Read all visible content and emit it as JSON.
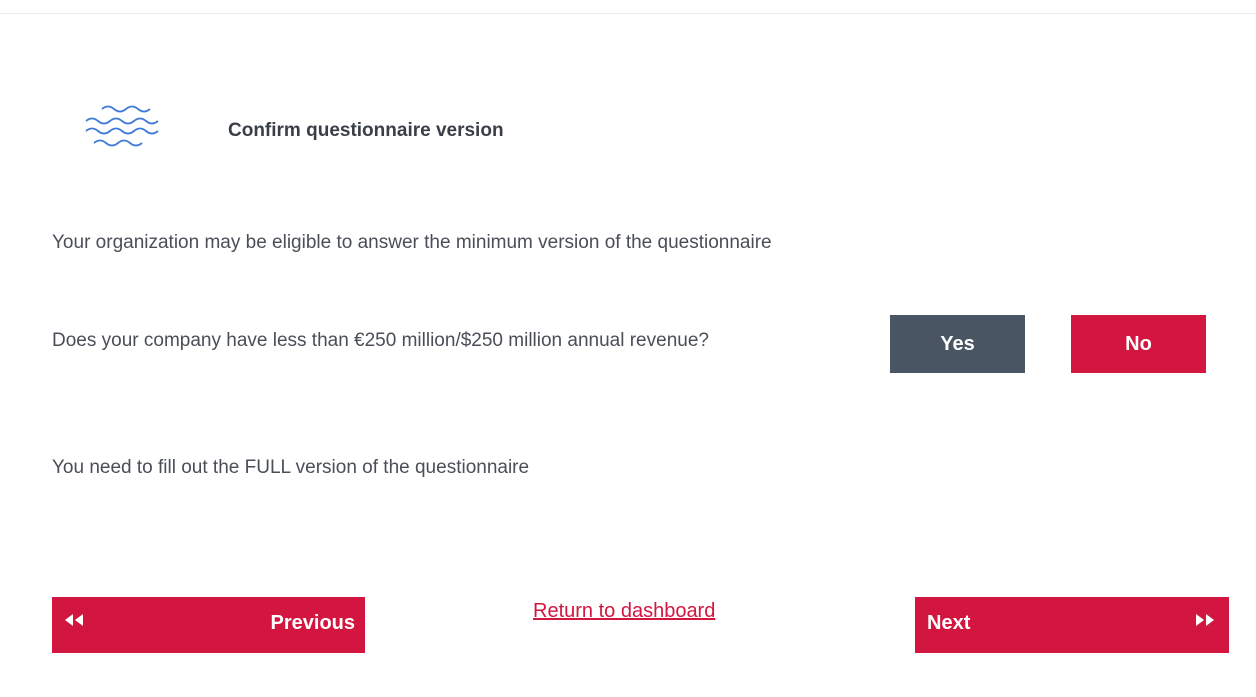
{
  "header": {
    "icon": "wave-icon",
    "title": "Confirm questionnaire version"
  },
  "intro_text": "Your organization may be eligible to answer the minimum version of the questionnaire",
  "question": {
    "text": "Does your company have less than €250 million/$250 million annual revenue?",
    "yes_label": "Yes",
    "no_label": "No"
  },
  "result_text": "You need to fill out the FULL version of the questionnaire",
  "navigation": {
    "previous_label": "Previous",
    "previous_icon": "double-chevron-left-icon",
    "dashboard_link": "Return to dashboard",
    "next_label": "Next",
    "next_icon": "double-chevron-right-icon"
  },
  "colors": {
    "accent": "#d3163f",
    "yes_button": "#4a5564",
    "wave_icon": "#3f7bd6",
    "text": "#4a4f57"
  }
}
